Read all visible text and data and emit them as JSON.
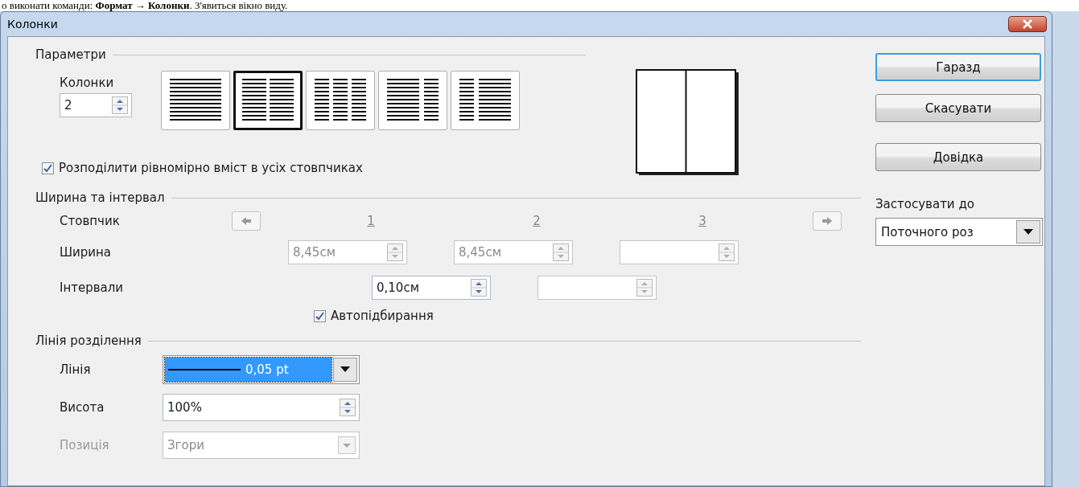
{
  "document_text": "о виконати команди: **Формат → Колонки**. З'явиться вікно виду.",
  "window": {
    "title": "Колонки"
  },
  "parameters": {
    "heading": "Параметри",
    "columns_label": "Колонки",
    "columns_value": "2",
    "presets": [
      {
        "kind": "one",
        "selected": false
      },
      {
        "kind": "two",
        "selected": true
      },
      {
        "kind": "three",
        "selected": false
      },
      {
        "kind": "left_wide",
        "selected": false
      },
      {
        "kind": "right_wide",
        "selected": false
      }
    ],
    "even_distribution": {
      "label": "Розподілити рівномірно вміст в усіх стовпчиках",
      "checked": true
    }
  },
  "width_spacing": {
    "heading": "Ширина та інтервал",
    "column_label": "Стовпчик",
    "column_numbers": [
      "1",
      "2",
      "3"
    ],
    "width_label": "Ширина",
    "widths": [
      {
        "value": "8,45см",
        "disabled": true
      },
      {
        "value": "8,45см",
        "disabled": true
      },
      {
        "disabled": true
      }
    ],
    "spacing_label": "Інтервали",
    "spacings": [
      {
        "value": "0,10см",
        "disabled": false
      },
      {
        "disabled": true
      }
    ],
    "autofit": {
      "label": "Автопідбирання",
      "checked": true
    }
  },
  "separator": {
    "heading": "Лінія розділення",
    "line_label": "Лінія",
    "line_value": "0,05 pt",
    "height_label": "Висота",
    "height_value": "100%",
    "position_label": "Позиція",
    "position_value": "Згори",
    "position_disabled": true
  },
  "buttons": [
    {
      "label": "Гаразд",
      "default": true
    },
    {
      "label": "Скасувати",
      "default": false
    },
    {
      "label": "Довідка",
      "default": false
    }
  ],
  "apply_to": {
    "label": "Застосувати до",
    "value": "Поточного роз"
  }
}
